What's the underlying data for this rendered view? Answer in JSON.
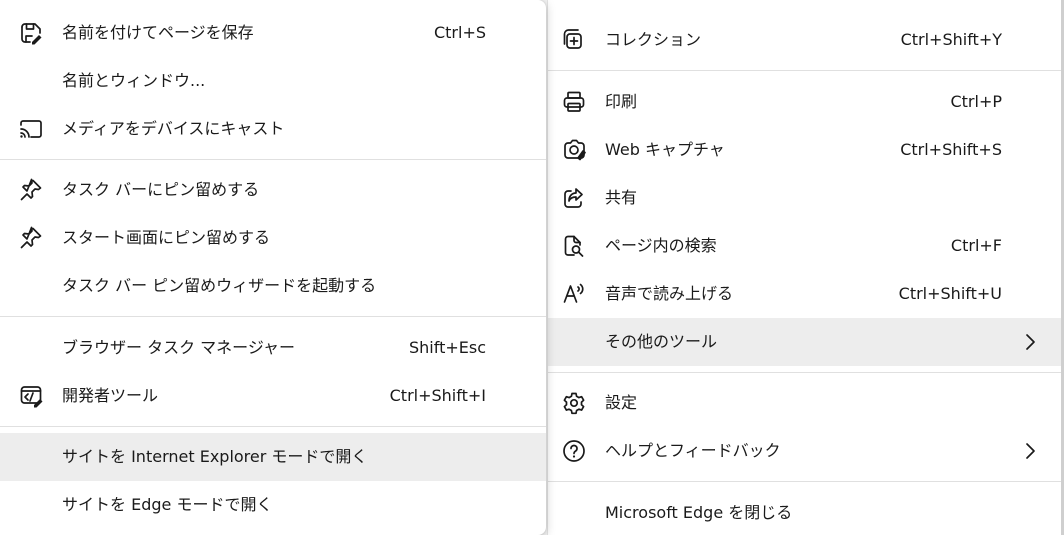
{
  "main_menu": {
    "items": [
      {
        "label": "コレクション",
        "shortcut": "Ctrl+Shift+Y"
      },
      {
        "label": "印刷",
        "shortcut": "Ctrl+P"
      },
      {
        "label": "Web キャプチャ",
        "shortcut": "Ctrl+Shift+S"
      },
      {
        "label": "共有",
        "shortcut": ""
      },
      {
        "label": "ページ内の検索",
        "shortcut": "Ctrl+F"
      },
      {
        "label": "音声で読み上げる",
        "shortcut": "Ctrl+Shift+U"
      },
      {
        "label": "その他のツール",
        "shortcut": ""
      },
      {
        "label": "設定",
        "shortcut": ""
      },
      {
        "label": "ヘルプとフィードバック",
        "shortcut": ""
      },
      {
        "label": "Microsoft Edge を閉じる",
        "shortcut": ""
      }
    ]
  },
  "submenu": {
    "items": [
      {
        "label": "名前を付けてページを保存",
        "shortcut": "Ctrl+S"
      },
      {
        "label": "名前とウィンドウ...",
        "shortcut": ""
      },
      {
        "label": "メディアをデバイスにキャスト",
        "shortcut": ""
      },
      {
        "label": "タスク バーにピン留めする",
        "shortcut": ""
      },
      {
        "label": "スタート画面にピン留めする",
        "shortcut": ""
      },
      {
        "label": "タスク バー ピン留めウィザードを起動する",
        "shortcut": ""
      },
      {
        "label": "ブラウザー タスク マネージャー",
        "shortcut": "Shift+Esc"
      },
      {
        "label": "開発者ツール",
        "shortcut": "Ctrl+Shift+I"
      },
      {
        "label": "サイトを Internet Explorer モードで開く",
        "shortcut": ""
      },
      {
        "label": "サイトを Edge モードで開く",
        "shortcut": ""
      }
    ]
  },
  "icons": {
    "main": [
      "collections-icon",
      "print-icon",
      "web-capture-icon",
      "share-icon",
      "find-in-page-icon",
      "read-aloud-icon",
      "settings-gear-icon",
      "help-icon"
    ],
    "sub": [
      "save-page-icon",
      "cast-icon",
      "pin-taskbar-icon",
      "pin-start-icon",
      "developer-tools-icon"
    ]
  },
  "colors": {
    "menu_background": "#ffffff",
    "hover_background": "#ededed",
    "separator": "#e0e0e0",
    "text": "#1a1a1a"
  }
}
